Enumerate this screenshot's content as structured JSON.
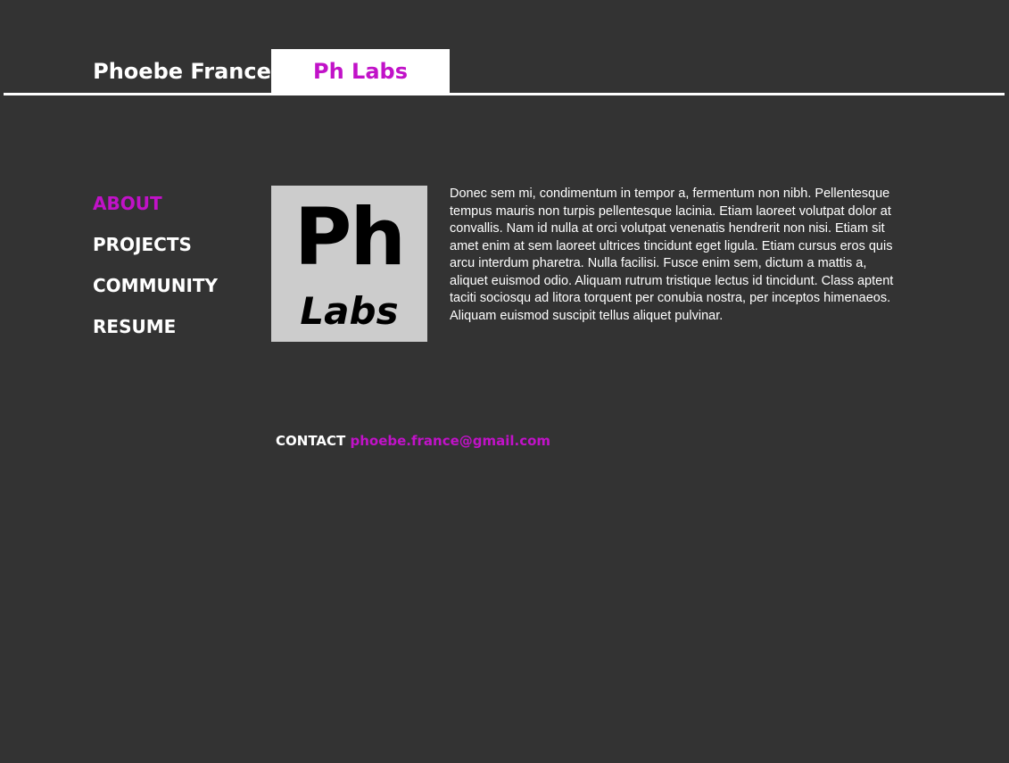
{
  "header": {
    "site_name": "Phoebe France",
    "active_tab": "Ph Labs"
  },
  "nav": {
    "items": [
      {
        "label": "ABOUT",
        "active": true
      },
      {
        "label": "PROJECTS",
        "active": false
      },
      {
        "label": "COMMUNITY",
        "active": false
      },
      {
        "label": "RESUME",
        "active": false
      }
    ]
  },
  "logo": {
    "line1": "Ph",
    "line2": "Labs"
  },
  "about": {
    "text": "Donec sem mi, condimentum in tempor a, fermentum non nibh. Pellentesque tempus mauris non turpis pellentesque lacinia. Etiam laoreet volutpat dolor at convallis. Nam id nulla at orci volutpat venenatis hendrerit non nisi. Etiam sit amet enim at sem laoreet ultrices tincidunt eget ligula. Etiam cursus eros quis arcu interdum pharetra. Nulla facilisi. Fusce enim sem, dictum a mattis a, aliquet euismod odio. Aliquam rutrum tristique lectus id tincidunt. Class aptent taciti sociosqu ad litora torquent per conubia nostra, per inceptos himenaeos. Aliquam euismod suscipit tellus aliquet pulvinar."
  },
  "contact": {
    "label": "CONTACT",
    "email": "phoebe.france@gmail.com"
  },
  "colors": {
    "background": "#333333",
    "accent": "#c112c8",
    "logo_bg": "#cccccc",
    "text": "#ffffff"
  }
}
